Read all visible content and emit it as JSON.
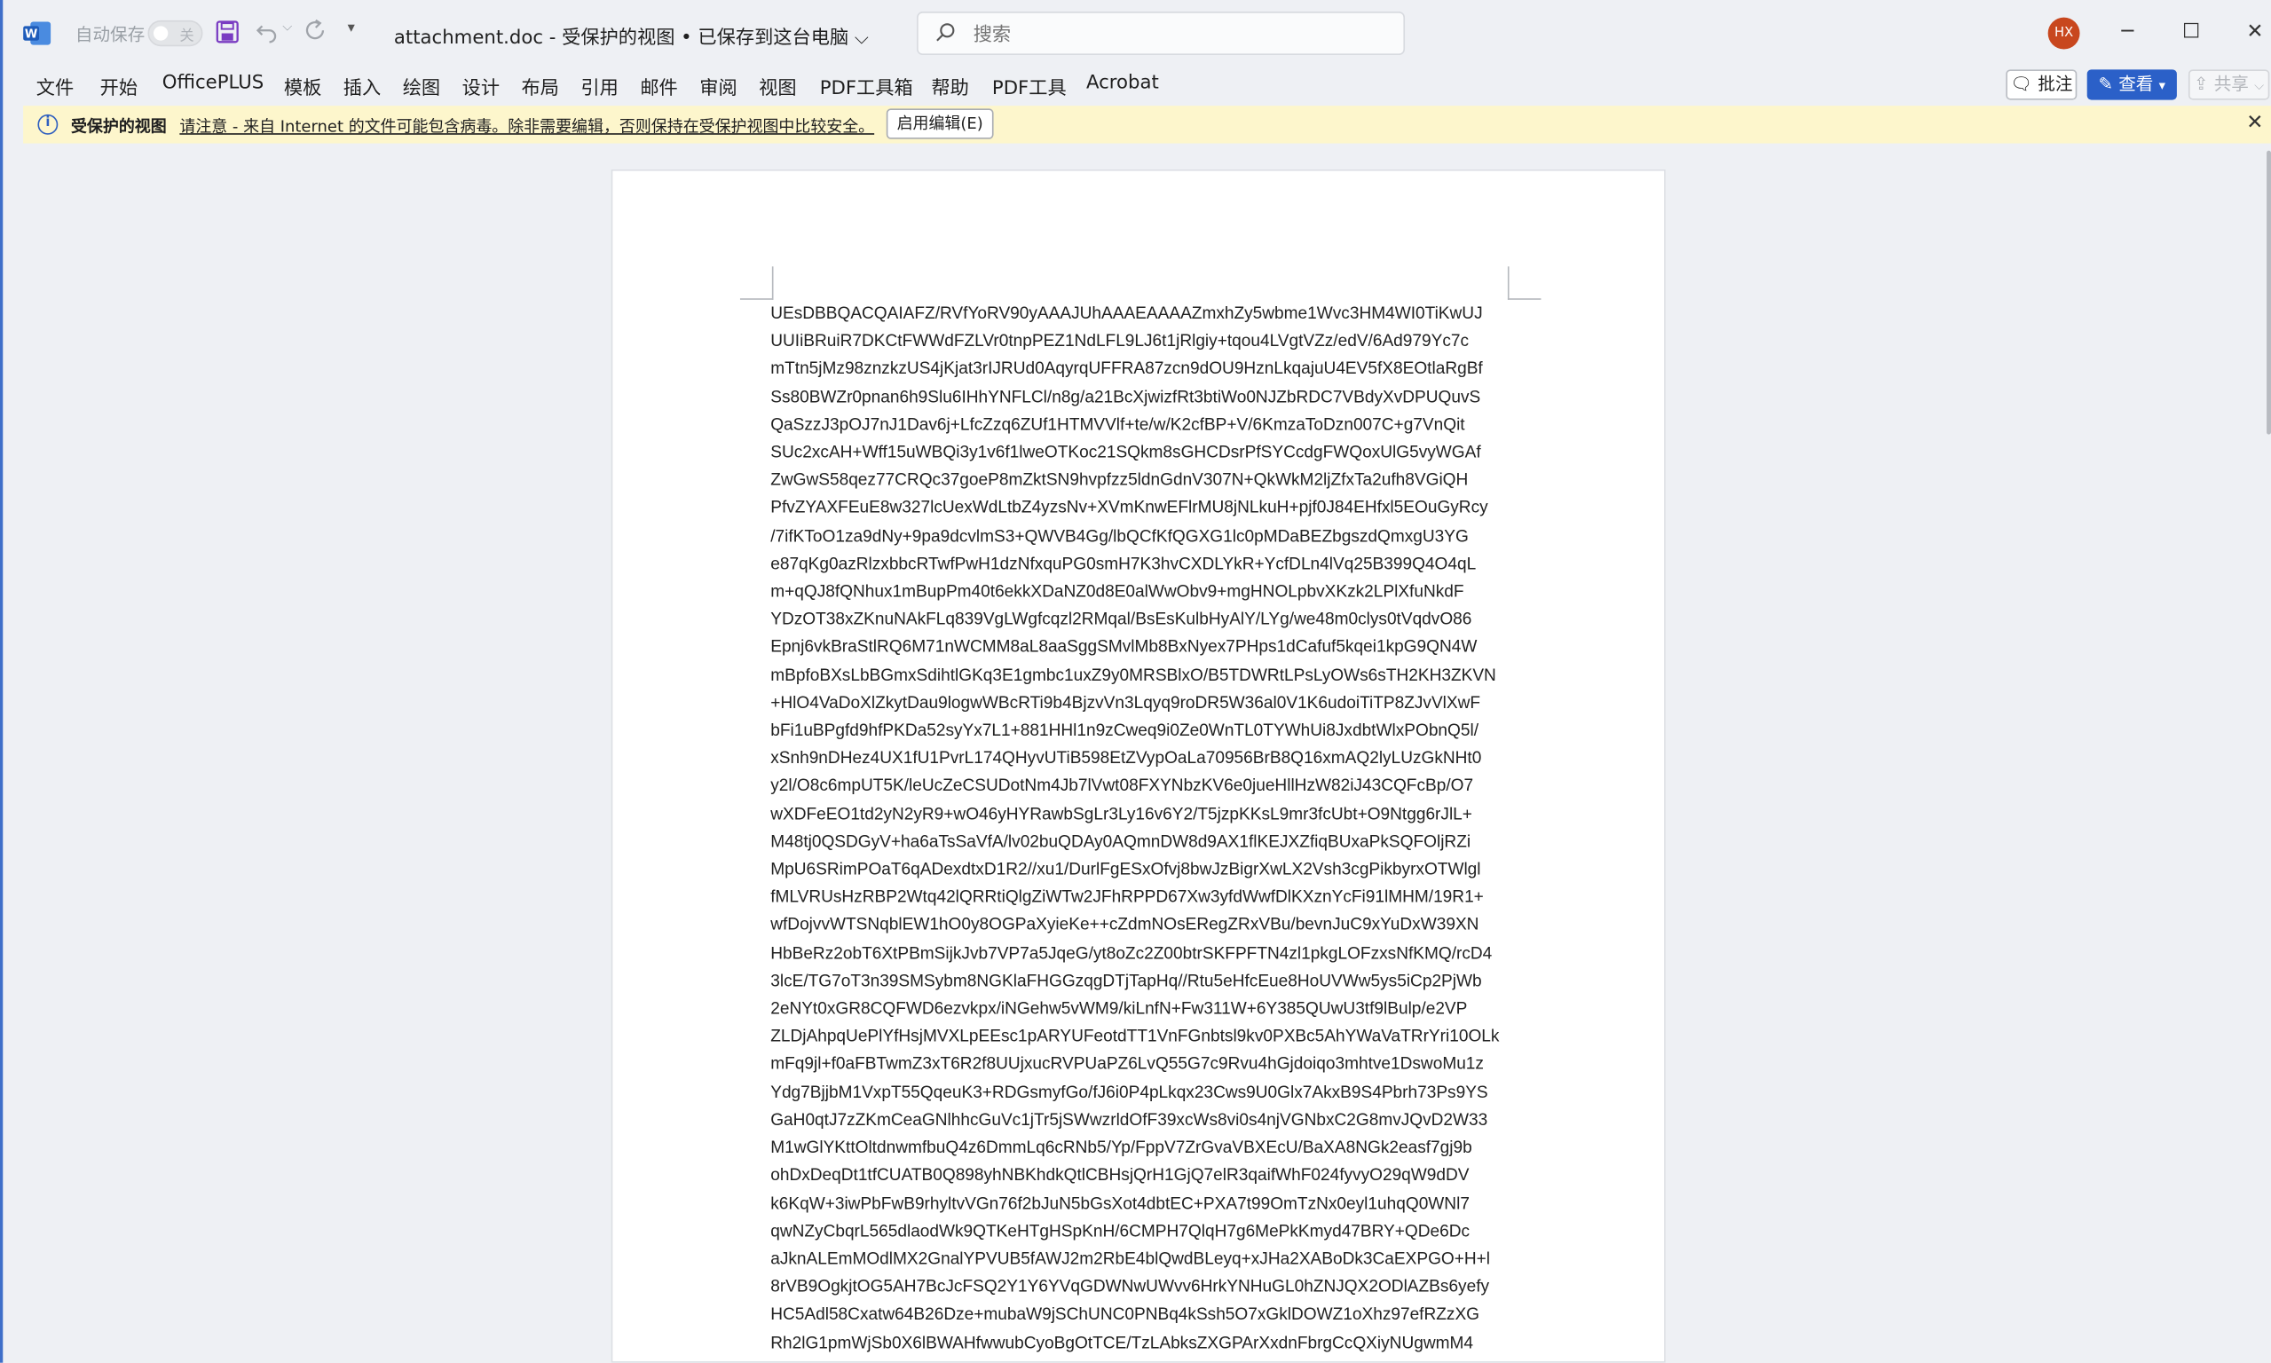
{
  "titlebar": {
    "autosave_label": "自动保存",
    "autosave_state": "关",
    "doc_title": "attachment.doc  -  受保护的视图 • 已保存到这台电脑 ⌵",
    "search_placeholder": "搜索",
    "avatar_initials": "HX"
  },
  "menu": {
    "items": [
      "文件",
      "开始",
      "OfficePLUS",
      "模板",
      "插入",
      "绘图",
      "设计",
      "布局",
      "引用",
      "邮件",
      "审阅",
      "视图",
      "PDF工具箱",
      "帮助",
      "PDF工具",
      "Acrobat"
    ],
    "comment_label": "批注",
    "view_label": "查看",
    "share_label": "共享"
  },
  "infobar": {
    "title": "受保护的视图",
    "message": "请注意 - 来自 Internet 的文件可能包含病毒。除非需要编辑，否则保持在受保护视图中比较安全。",
    "enable_button": "启用编辑(E)"
  },
  "document": {
    "lines": [
      "UEsDBBQACQAIAFZ/RVfYoRV90yAAAJUhAAAEAAAAZmxhZy5wbme1Wvc3HM4WI0TiKwUJ",
      "UUIiBRuiR7DKCtFWWdFZLVr0tnpPEZ1NdLFL9LJ6t1jRlgiy+tqou4LVgtVZz/edV/6Ad979Yc7c",
      "mTtn5jMz98znzkzUS4jKjat3rIJRUd0AqyrqUFFRA87zcn9dOU9HznLkqajuU4EV5fX8EOtlaRgBf",
      "Ss80BWZr0pnan6h9Slu6IHhYNFLCl/n8g/a21BcXjwizfRt3btiWo0NJZbRDC7VBdyXvDPUQuvS",
      "QaSzzJ3pOJ7nJ1Dav6j+LfcZzq6ZUf1HTMVVlf+te/w/K2cfBP+V/6KmzaToDzn007C+g7VnQit",
      "SUc2xcAH+Wff15uWBQi3y1v6f1lweOTKoc21SQkm8sGHCDsrPfSYCcdgFWQoxUlG5vyWGAf",
      "ZwGwS58qez77CRQc37goeP8mZktSN9hvpfzz5ldnGdnV307N+QkWkM2ljZfxTa2ufh8VGiQH",
      "PfvZYAXFEuE8w327lcUexWdLtbZ4yzsNv+XVmKnwEFlrMU8jNLkuH+pjf0J84EHfxl5EOuGyRcy",
      "/7ifKToO1za9dNy+9pa9dcvlmS3+QWVB4Gg/lbQCfKfQGXG1lc0pMDaBEZbgszdQmxgU3YG",
      "e87qKg0azRlzxbbcRTwfPwH1dzNfxquPG0smH7K3hvCXDLYkR+YcfDLn4lVq25B399Q4O4qL",
      "m+qQJ8fQNhux1mBupPm40t6ekkXDaNZ0d8E0alWwObv9+mgHNOLpbvXKzk2LPlXfuNkdF",
      "YDzOT38xZKnuNAkFLq839VgLWgfcqzl2RMqal/BsEsKulbHyAlY/LYg/we48m0clys0tVqdvO86",
      "Epnj6vkBraStlRQ6M71nWCMM8aL8aaSggSMvlMb8BxNyex7PHps1dCafuf5kqei1kpG9QN4W",
      "mBpfoBXsLbBGmxSdihtlGKq3E1gmbc1uxZ9y0MRSBlxO/B5TDWRtLPsLyOWs6sTH2KH3ZKVN",
      "+HlO4VaDoXlZkytDau9logwWBcRTi9b4BjzvVn3Lqyq9roDR5W36al0V1K6udoiTiTP8ZJvVlXwF",
      "bFi1uBPgfd9hfPKDa52syYx7L1+881HHl1n9zCweq9i0Ze0WnTL0TYWhUi8JxdbtWlxPObnQ5l/",
      "xSnh9nDHez4UX1fU1PvrL174QHyvUTiB598EtZVypOaLa70956BrB8Q16xmAQ2lyLUzGkNHt0",
      "y2l/O8c6mpUT5K/leUcZeCSUDotNm4Jb7lVwt08FXYNbzKV6e0jueHllHzW82iJ43CQFcBp/O7",
      "wXDFeEO1td2yN2yR9+wO46yHYRawbSgLr3Ly16v6Y2/T5jzpKKsL9mr3fcUbt+O9Ntgg6rJlL+",
      "M48tj0QSDGyV+ha6aTsSaVfA/lv02buQDAy0AQmnDW8d9AX1flKEJXZfiqBUxaPkSQFOljRZi",
      "MpU6SRimPOaT6qADexdtxD1R2//xu1/DurlFgESxOfvj8bwJzBigrXwLX2Vsh3cgPikbyrxOTWlgl",
      "fMLVRUsHzRBP2Wtq42lQRRtiQlgZiWTw2JFhRPPD67Xw3yfdWwfDlKXznYcFi91lMHM/19R1+",
      "wfDojvvWTSNqblEW1hO0y8OGPaXyieKe++cZdmNOsERegZRxVBu/bevnJuC9xYuDxW39XN",
      "HbBeRz2obT6XtPBmSijkJvb7VP7a5JqeG/yt8oZc2Z00btrSKFPFTN4zl1pkgLOFzxsNfKMQ/rcD4",
      "3lcE/TG7oT3n39SMSybm8NGKlaFHGGzqgDTjTapHq//Rtu5eHfcEue8HoUVWw5ys5iCp2PjWb",
      "2eNYt0xGR8CQFWD6ezvkpx/iNGehw5vWM9/kiLnfN+Fw311W+6Y385QUwU3tf9lBulp/e2VP",
      "ZLDjAhpqUePlYfHsjMVXLpEEsc1pARYUFeotdTT1VnFGnbtsl9kv0PXBc5AhYWaVaTRrYri10OLk",
      "mFq9jl+f0aFBTwmZ3xT6R2f8UUjxucRVPUaPZ6LvQ55G7c9Rvu4hGjdoiqo3mhtve1DswoMu1z",
      "Ydg7BjjbM1VxpT55QqeuK3+RDGsmyfGo/fJ6i0P4pLkqx23Cws9U0Glx7AkxB9S4Pbrh73Ps9YS",
      "GaH0qtJ7zZKmCeaGNlhhcGuVc1jTr5jSWwzrldOfF39xcWs8vi0s4njVGNbxC2G8mvJQvD2W33",
      "M1wGlYKttOltdnwmfbuQ4z6DmmLq6cRNb5/Yp/FppV7ZrGvaVBXEcU/BaXA8NGk2easf7gj9b",
      "ohDxDeqDt1tfCUATB0Q898yhNBKhdkQtlCBHsjQrH1GjQ7elR3qaifWhF024fyvyO29qW9dDV",
      "k6KqW+3iwPbFwB9rhyltvVGn76f2bJuN5bGsXot4dbtEC+PXA7t99OmTzNx0eyl1uhqQ0WNl7",
      "qwNZyCbqrL565dlaodWk9QTKeHTgHSpKnH/6CMPH7QlqH7g6MePkKmyd47BRY+QDe6Dc",
      "aJknALEmMOdlMX2GnalYPVUB5fAWJ2m2RbE4blQwdBLeyq+xJHa2XABoDk3CaEXPGO+H+l",
      "8rVB9OgkjtOG5AH7BcJcFSQ2Y1Y6YVqGDWNwUWvv6HrkYNHuGL0hZNJQX2ODlAZBs6yefy",
      "HC5Adl58Cxatw64B26Dze+mubaW9jSChUNC0PNBq4kSsh5O7xGklDOWZ1oXhz97efRZzXG",
      "Rh2lG1pmWjSb0X6lBWAHfwwubCyoBgOtTCE/TzLAbksZXGPArXxdnFbrgCcQXiyNUgwmM4"
    ]
  }
}
